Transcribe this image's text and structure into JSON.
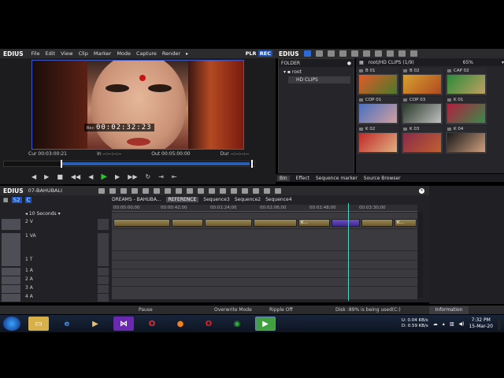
{
  "app": {
    "brand": "EDIUS",
    "menu": [
      "File",
      "Edit",
      "View",
      "Clip",
      "Marker",
      "Mode",
      "Capture",
      "Render"
    ],
    "more_indicator": "▸",
    "plr": "PLR",
    "rec": "REC"
  },
  "player": {
    "timecode_prefix": "Rec",
    "timecode": "00:02:32:23",
    "cur_label": "Cur",
    "cur_value": "00:03:00:21",
    "in_label": "In",
    "in_value": "--:--:--:--",
    "out_label": "Out",
    "out_value": "00:05:00:00",
    "dur_label": "Dur",
    "dur_value": "--:--:--:--",
    "progress_fraction": 0.22
  },
  "bin": {
    "brand": "EDIUS",
    "folder_header": "FOLDER",
    "tree_root": "root",
    "tree_child": "HD CLIPS",
    "path": "root/HD CLIPS (1/9)",
    "zoom": "65%",
    "clips": [
      {
        "label": "B 01",
        "color1": "#e05a2a",
        "color2": "#4a7a2a"
      },
      {
        "label": "B 02",
        "color1": "#d8a030",
        "color2": "#b04a20"
      },
      {
        "label": "CAP 02",
        "color1": "#2a8a3a",
        "color2": "#c0a060"
      },
      {
        "label": "COP 01",
        "color1": "#4a70c0",
        "color2": "#d0a0a0"
      },
      {
        "label": "COP 03",
        "color1": "#2a3a2a",
        "color2": "#c0c0c0"
      },
      {
        "label": "K 01",
        "color1": "#b02040",
        "color2": "#3a8a4a"
      },
      {
        "label": "K 02",
        "color1": "#c02a2a",
        "color2": "#e0b080"
      },
      {
        "label": "K 03",
        "color1": "#8a2a4a",
        "color2": "#c06030"
      },
      {
        "label": "K 04",
        "color1": "#1a1a1a",
        "color2": "#d0a080"
      }
    ],
    "tabs": [
      "Bin",
      "Effect",
      "Sequence marker",
      "Source Browser"
    ]
  },
  "timeline": {
    "brand": "EDIUS",
    "project": "07-BAHUBALI",
    "scale": "10 Seconds",
    "sequence_tabs": [
      "DREAMS - BAHUBA...",
      "REFERENCE",
      "Sequence3",
      "Sequence2",
      "Sequence4"
    ],
    "active_tab": "REFERENCE",
    "ruler": [
      "00:00:00;00",
      "00:00:42;00",
      "00:01:24;00",
      "00:02:06;00",
      "00:02:48;00",
      "00:03:30;00"
    ],
    "tracks": [
      "2 V",
      "1 VA",
      "1 T",
      "1 A",
      "2 A",
      "3 A",
      "4 A"
    ],
    "clip_marker": "K..."
  },
  "status": {
    "pause": "Pause",
    "mode": "Overwrite Mode",
    "ripple": "Ripple Off",
    "disk": "Disk :89% is being used(C:)",
    "information": "Information"
  },
  "taskbar": {
    "upload_label": "U:",
    "upload": "0.04 KB/s",
    "download_label": "D:",
    "download": "0.59 KB/s",
    "time": "7:32 PM",
    "date": "15-Mar-20"
  }
}
